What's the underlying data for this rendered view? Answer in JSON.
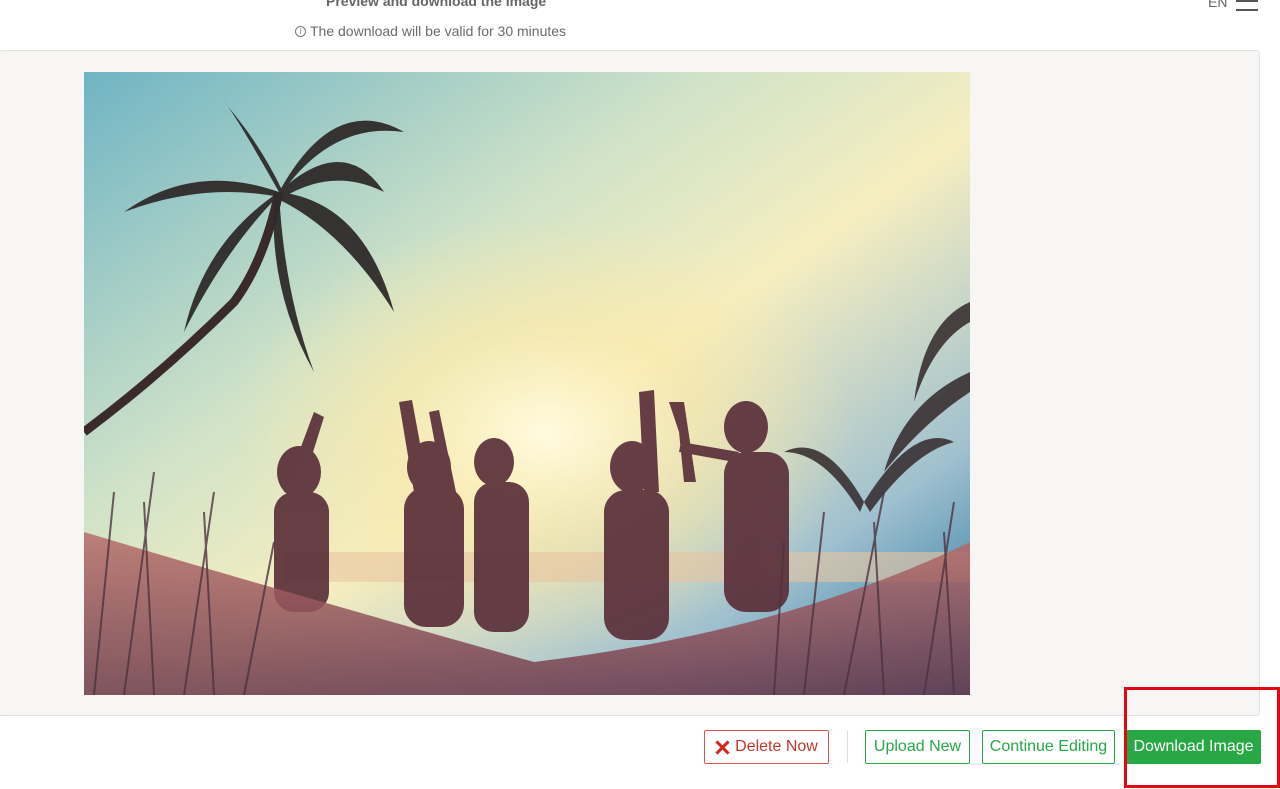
{
  "header": {
    "title": "Preview and download the image",
    "valid_note": "The download will be valid for 30 minutes",
    "info_icon": "info-icon",
    "language": "EN",
    "menu_icon": "hamburger-menu-icon"
  },
  "preview": {
    "image_description_icon": "beach-party-photo"
  },
  "actions": {
    "delete_label": "Delete Now",
    "upload_label": "Upload New",
    "continue_label": "Continue Editing",
    "download_label": "Download Image"
  },
  "colors": {
    "accent_green": "#28a745",
    "danger_red": "#d9534f",
    "highlight_red": "#e30613"
  }
}
